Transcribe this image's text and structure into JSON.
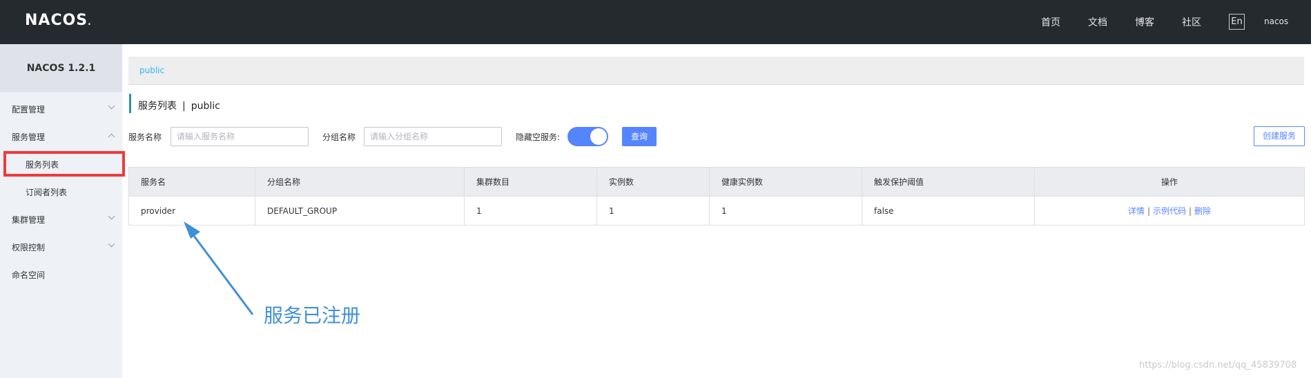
{
  "header": {
    "logo_text": "NACOS",
    "logo_suffix": ".",
    "nav": [
      "首页",
      "文档",
      "博客",
      "社区"
    ],
    "lang_button": "En",
    "user": "nacos",
    "bg_color": "#252a2f"
  },
  "sidebar": {
    "version": "NACOS 1.2.1",
    "items": [
      {
        "label": "配置管理",
        "expanded": false
      },
      {
        "label": "服务管理",
        "expanded": true
      },
      {
        "label": "集群管理",
        "expanded": false
      },
      {
        "label": "权限控制",
        "expanded": false
      },
      {
        "label": "命名空间"
      }
    ],
    "sub_items": [
      {
        "label": "服务列表",
        "selected": true
      },
      {
        "label": "订阅者列表"
      }
    ]
  },
  "breadcrumb": "public",
  "page": {
    "title": "服务列表",
    "separator": "|",
    "namespace": "public"
  },
  "filters": {
    "service_name_label": "服务名称",
    "service_name_placeholder": "请输入服务名称",
    "group_name_label": "分组名称",
    "group_name_placeholder": "请输入分组名称",
    "hide_empty_label": "隐藏空服务:",
    "hide_empty_on": true,
    "query_button": "查询",
    "create_button": "创建服务"
  },
  "table": {
    "headers": [
      "服务名",
      "分组名称",
      "集群数目",
      "实例数",
      "健康实例数",
      "触发保护阈值",
      "操作"
    ],
    "rows": [
      {
        "service": "provider",
        "group": "DEFAULT_GROUP",
        "clusters": "1",
        "instances": "1",
        "healthy": "1",
        "threshold": "false",
        "actions": [
          "详情",
          "示例代码",
          "删除"
        ],
        "action_sep": "|"
      }
    ]
  },
  "annotation": {
    "text": "服务已注册",
    "color": "#3f8fd9"
  },
  "watermark": "https://blog.csdn.net/qq_45839708",
  "colors": {
    "primary": "#5584ff",
    "highlight": "#ef3a3a",
    "breadcrumb": "#2db7f5"
  }
}
